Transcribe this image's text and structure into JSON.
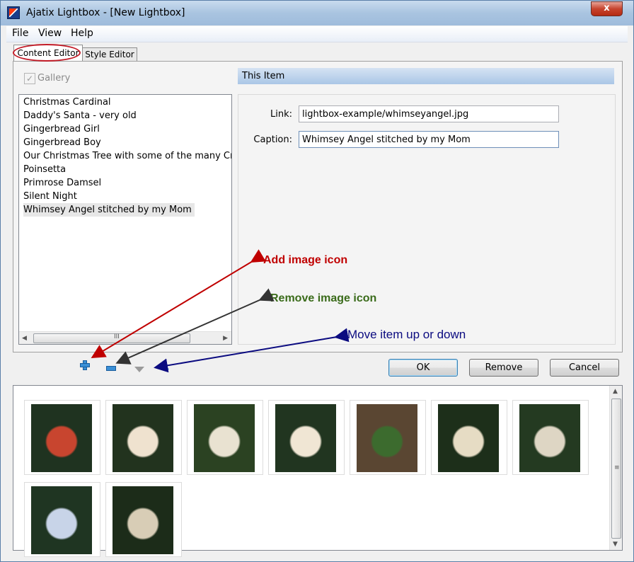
{
  "window": {
    "title": "Ajatix Lightbox - [New Lightbox]",
    "close_glyph": "x"
  },
  "menu": {
    "items": [
      "File",
      "View",
      "Help"
    ]
  },
  "tabs": {
    "content_editor": "Content Editor",
    "style_editor": "Style Editor"
  },
  "gallery": {
    "label": "Gallery",
    "checked": true
  },
  "items": [
    "Christmas Cardinal",
    "Daddy's Santa - very old",
    "Gingerbread Girl",
    "Gingerbread Boy",
    "Our Christmas Tree with some of the many Cross Stitch",
    "Poinsetta",
    "Primrose Damsel",
    "Silent Night",
    "Whimsey Angel stitched by my Mom"
  ],
  "selected_index": 8,
  "detail": {
    "header": "This Item",
    "link_label": "Link:",
    "link_value": "lightbox-example/whimseyangel.jpg",
    "caption_label": "Caption:",
    "caption_value": "Whimsey Angel stitched by my Mom"
  },
  "buttons": {
    "ok": "OK",
    "remove": "Remove",
    "cancel": "Cancel"
  },
  "icons": {
    "add": "plus-icon",
    "remove": "minus-icon",
    "move_down": "triangle-down-icon",
    "move_up": "triangle-up-icon"
  },
  "scrollbar": {
    "left": "◀",
    "right": "▶",
    "up": "▲",
    "down": "▼",
    "grip_h": "III",
    "grip_v": "≡"
  },
  "annotations": {
    "add": {
      "text": "Add image icon",
      "color": "#c00000"
    },
    "remove": {
      "text": "Remove image icon",
      "color": "#3a6b1a"
    },
    "move": {
      "text": "Move item up or down",
      "color": "#0b0b80"
    }
  },
  "thumbnails": [
    {
      "name": "Christmas Cardinal",
      "bg": "#1f3320",
      "fg": "#c8452f"
    },
    {
      "name": "Daddy's Santa",
      "bg": "#22331e",
      "fg": "#efe2cf"
    },
    {
      "name": "Gingerbread Girl",
      "bg": "#2b4222",
      "fg": "#e9e2d1"
    },
    {
      "name": "Gingerbread Boy",
      "bg": "#213520",
      "fg": "#f0e6d4"
    },
    {
      "name": "Christmas Tree",
      "bg": "#5a4632",
      "fg": "#3c6b2e"
    },
    {
      "name": "Poinsetta",
      "bg": "#1d2f1a",
      "fg": "#e6dcc4"
    },
    {
      "name": "Primrose Damsel",
      "bg": "#243a21",
      "fg": "#ded6c4"
    },
    {
      "name": "Silent Night",
      "bg": "#1f3522",
      "fg": "#c8d4e8"
    },
    {
      "name": "Whimsey Angel",
      "bg": "#1c2c19",
      "fg": "#d8cdb6"
    }
  ]
}
